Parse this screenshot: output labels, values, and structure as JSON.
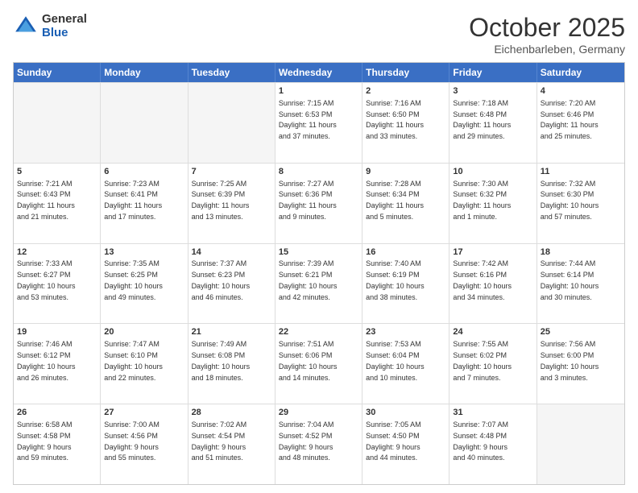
{
  "logo": {
    "general": "General",
    "blue": "Blue"
  },
  "header": {
    "month": "October 2025",
    "location": "Eichenbarleben, Germany"
  },
  "weekdays": [
    "Sunday",
    "Monday",
    "Tuesday",
    "Wednesday",
    "Thursday",
    "Friday",
    "Saturday"
  ],
  "rows": [
    [
      {
        "day": "",
        "info": ""
      },
      {
        "day": "",
        "info": ""
      },
      {
        "day": "",
        "info": ""
      },
      {
        "day": "1",
        "info": "Sunrise: 7:15 AM\nSunset: 6:53 PM\nDaylight: 11 hours\nand 37 minutes."
      },
      {
        "day": "2",
        "info": "Sunrise: 7:16 AM\nSunset: 6:50 PM\nDaylight: 11 hours\nand 33 minutes."
      },
      {
        "day": "3",
        "info": "Sunrise: 7:18 AM\nSunset: 6:48 PM\nDaylight: 11 hours\nand 29 minutes."
      },
      {
        "day": "4",
        "info": "Sunrise: 7:20 AM\nSunset: 6:46 PM\nDaylight: 11 hours\nand 25 minutes."
      }
    ],
    [
      {
        "day": "5",
        "info": "Sunrise: 7:21 AM\nSunset: 6:43 PM\nDaylight: 11 hours\nand 21 minutes."
      },
      {
        "day": "6",
        "info": "Sunrise: 7:23 AM\nSunset: 6:41 PM\nDaylight: 11 hours\nand 17 minutes."
      },
      {
        "day": "7",
        "info": "Sunrise: 7:25 AM\nSunset: 6:39 PM\nDaylight: 11 hours\nand 13 minutes."
      },
      {
        "day": "8",
        "info": "Sunrise: 7:27 AM\nSunset: 6:36 PM\nDaylight: 11 hours\nand 9 minutes."
      },
      {
        "day": "9",
        "info": "Sunrise: 7:28 AM\nSunset: 6:34 PM\nDaylight: 11 hours\nand 5 minutes."
      },
      {
        "day": "10",
        "info": "Sunrise: 7:30 AM\nSunset: 6:32 PM\nDaylight: 11 hours\nand 1 minute."
      },
      {
        "day": "11",
        "info": "Sunrise: 7:32 AM\nSunset: 6:30 PM\nDaylight: 10 hours\nand 57 minutes."
      }
    ],
    [
      {
        "day": "12",
        "info": "Sunrise: 7:33 AM\nSunset: 6:27 PM\nDaylight: 10 hours\nand 53 minutes."
      },
      {
        "day": "13",
        "info": "Sunrise: 7:35 AM\nSunset: 6:25 PM\nDaylight: 10 hours\nand 49 minutes."
      },
      {
        "day": "14",
        "info": "Sunrise: 7:37 AM\nSunset: 6:23 PM\nDaylight: 10 hours\nand 46 minutes."
      },
      {
        "day": "15",
        "info": "Sunrise: 7:39 AM\nSunset: 6:21 PM\nDaylight: 10 hours\nand 42 minutes."
      },
      {
        "day": "16",
        "info": "Sunrise: 7:40 AM\nSunset: 6:19 PM\nDaylight: 10 hours\nand 38 minutes."
      },
      {
        "day": "17",
        "info": "Sunrise: 7:42 AM\nSunset: 6:16 PM\nDaylight: 10 hours\nand 34 minutes."
      },
      {
        "day": "18",
        "info": "Sunrise: 7:44 AM\nSunset: 6:14 PM\nDaylight: 10 hours\nand 30 minutes."
      }
    ],
    [
      {
        "day": "19",
        "info": "Sunrise: 7:46 AM\nSunset: 6:12 PM\nDaylight: 10 hours\nand 26 minutes."
      },
      {
        "day": "20",
        "info": "Sunrise: 7:47 AM\nSunset: 6:10 PM\nDaylight: 10 hours\nand 22 minutes."
      },
      {
        "day": "21",
        "info": "Sunrise: 7:49 AM\nSunset: 6:08 PM\nDaylight: 10 hours\nand 18 minutes."
      },
      {
        "day": "22",
        "info": "Sunrise: 7:51 AM\nSunset: 6:06 PM\nDaylight: 10 hours\nand 14 minutes."
      },
      {
        "day": "23",
        "info": "Sunrise: 7:53 AM\nSunset: 6:04 PM\nDaylight: 10 hours\nand 10 minutes."
      },
      {
        "day": "24",
        "info": "Sunrise: 7:55 AM\nSunset: 6:02 PM\nDaylight: 10 hours\nand 7 minutes."
      },
      {
        "day": "25",
        "info": "Sunrise: 7:56 AM\nSunset: 6:00 PM\nDaylight: 10 hours\nand 3 minutes."
      }
    ],
    [
      {
        "day": "26",
        "info": "Sunrise: 6:58 AM\nSunset: 4:58 PM\nDaylight: 9 hours\nand 59 minutes."
      },
      {
        "day": "27",
        "info": "Sunrise: 7:00 AM\nSunset: 4:56 PM\nDaylight: 9 hours\nand 55 minutes."
      },
      {
        "day": "28",
        "info": "Sunrise: 7:02 AM\nSunset: 4:54 PM\nDaylight: 9 hours\nand 51 minutes."
      },
      {
        "day": "29",
        "info": "Sunrise: 7:04 AM\nSunset: 4:52 PM\nDaylight: 9 hours\nand 48 minutes."
      },
      {
        "day": "30",
        "info": "Sunrise: 7:05 AM\nSunset: 4:50 PM\nDaylight: 9 hours\nand 44 minutes."
      },
      {
        "day": "31",
        "info": "Sunrise: 7:07 AM\nSunset: 4:48 PM\nDaylight: 9 hours\nand 40 minutes."
      },
      {
        "day": "",
        "info": ""
      }
    ]
  ]
}
